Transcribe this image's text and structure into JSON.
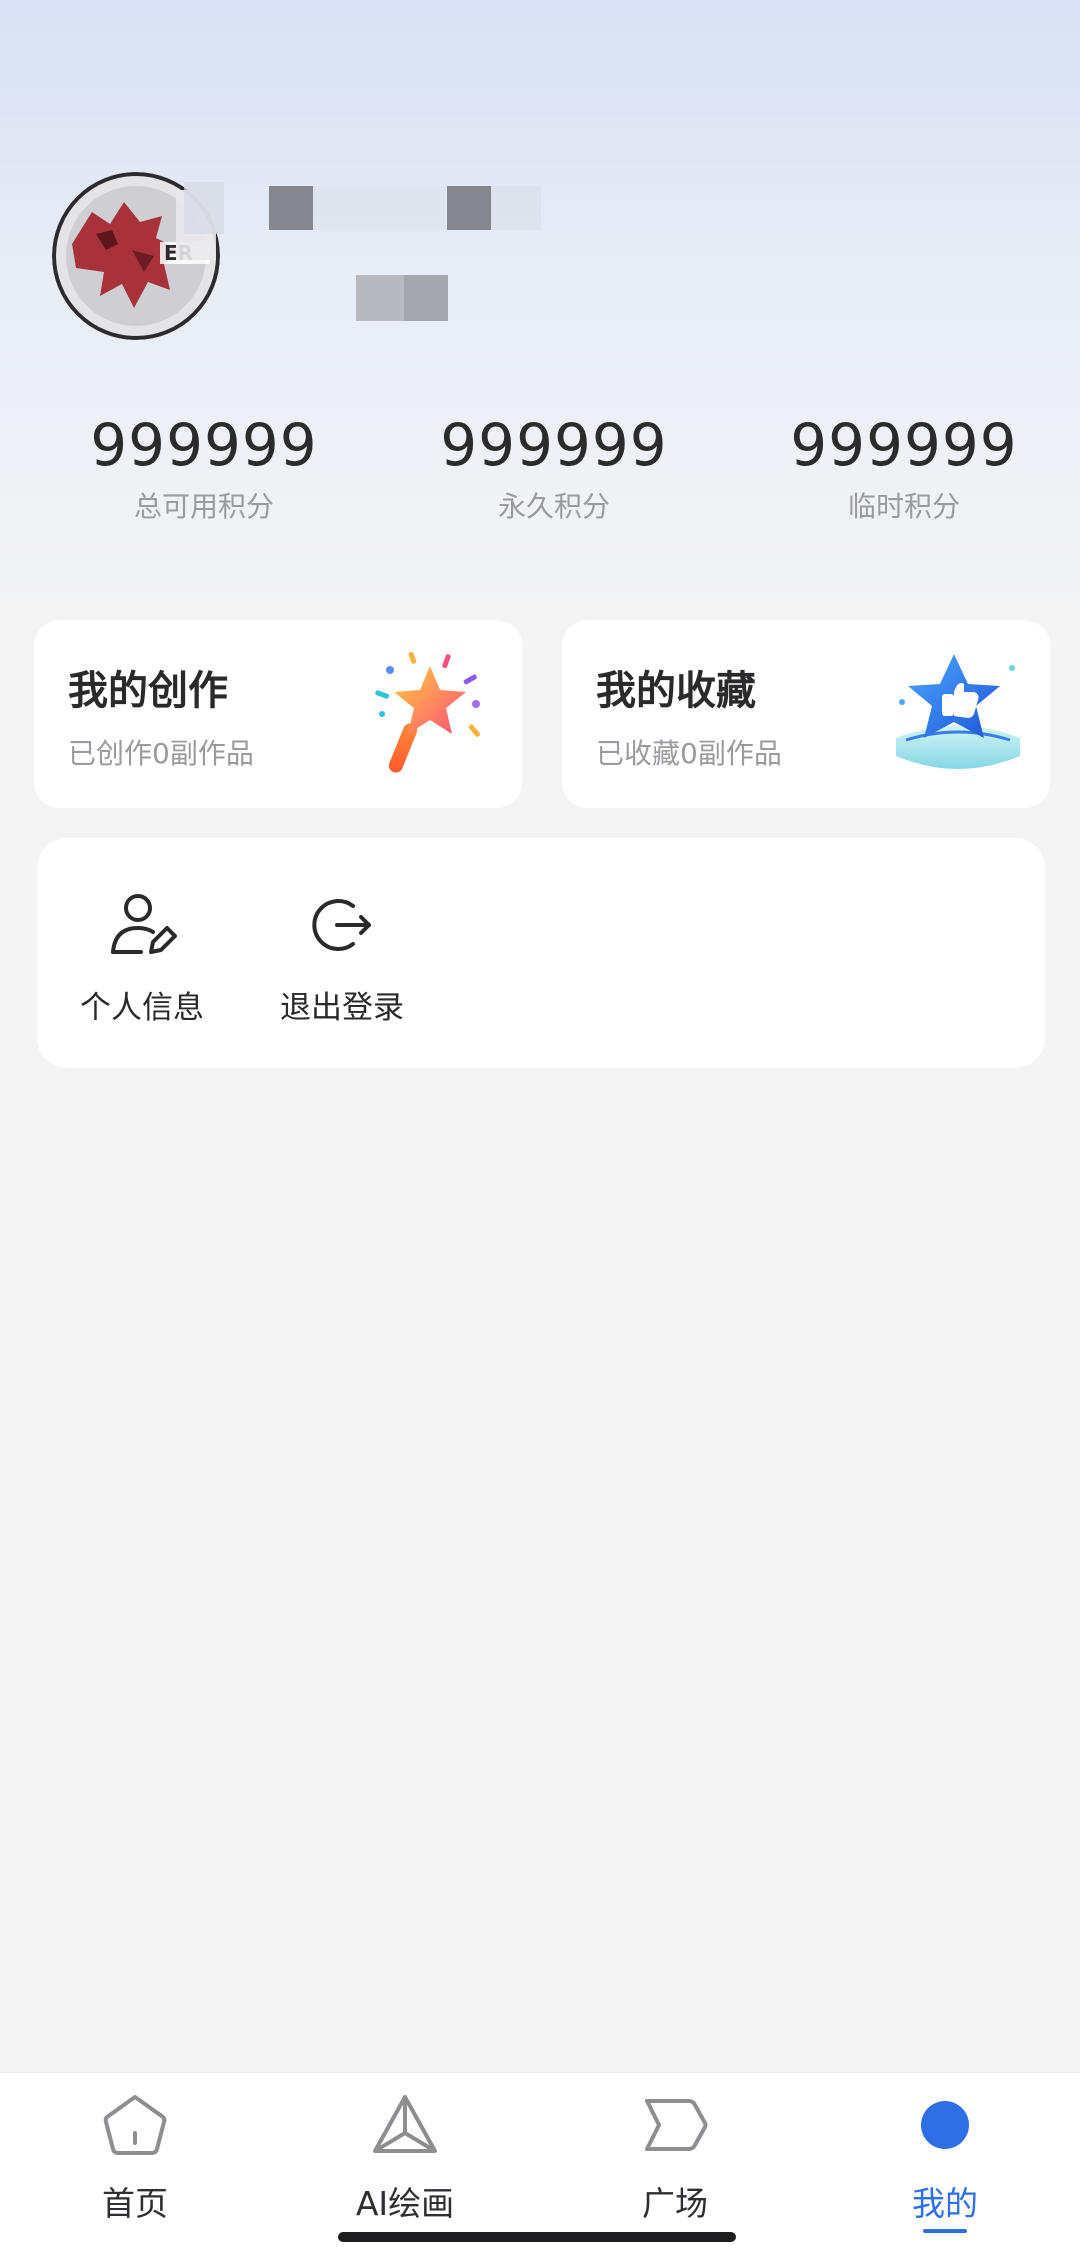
{
  "stats": [
    {
      "value": "999999",
      "label": "总可用积分"
    },
    {
      "value": "999999",
      "label": "永久积分"
    },
    {
      "value": "999999",
      "label": "临时积分"
    }
  ],
  "cards": {
    "creation": {
      "title": "我的创作",
      "subtitle": "已创作0副作品",
      "icon": "magic-wand-star-icon"
    },
    "favorites": {
      "title": "我的收藏",
      "subtitle": "已收藏0副作品",
      "icon": "thumbs-up-star-icon"
    }
  },
  "functions": [
    {
      "label": "个人信息",
      "icon": "user-edit-icon"
    },
    {
      "label": "退出登录",
      "icon": "logout-icon"
    }
  ],
  "tabbar": {
    "items": [
      {
        "label": "首页",
        "icon": "home-pentagon-icon"
      },
      {
        "label": "AI绘画",
        "icon": "triangle-icon"
      },
      {
        "label": "广场",
        "icon": "chevron-tag-icon"
      },
      {
        "label": "我的",
        "icon": "profile-dot-icon"
      }
    ],
    "active": "我的"
  },
  "colors": {
    "accent": "#2f6fe6",
    "card_bg": "#ffffff",
    "page_bg": "#f4f4f5",
    "header_gradient_top": "#d8e2f4"
  }
}
